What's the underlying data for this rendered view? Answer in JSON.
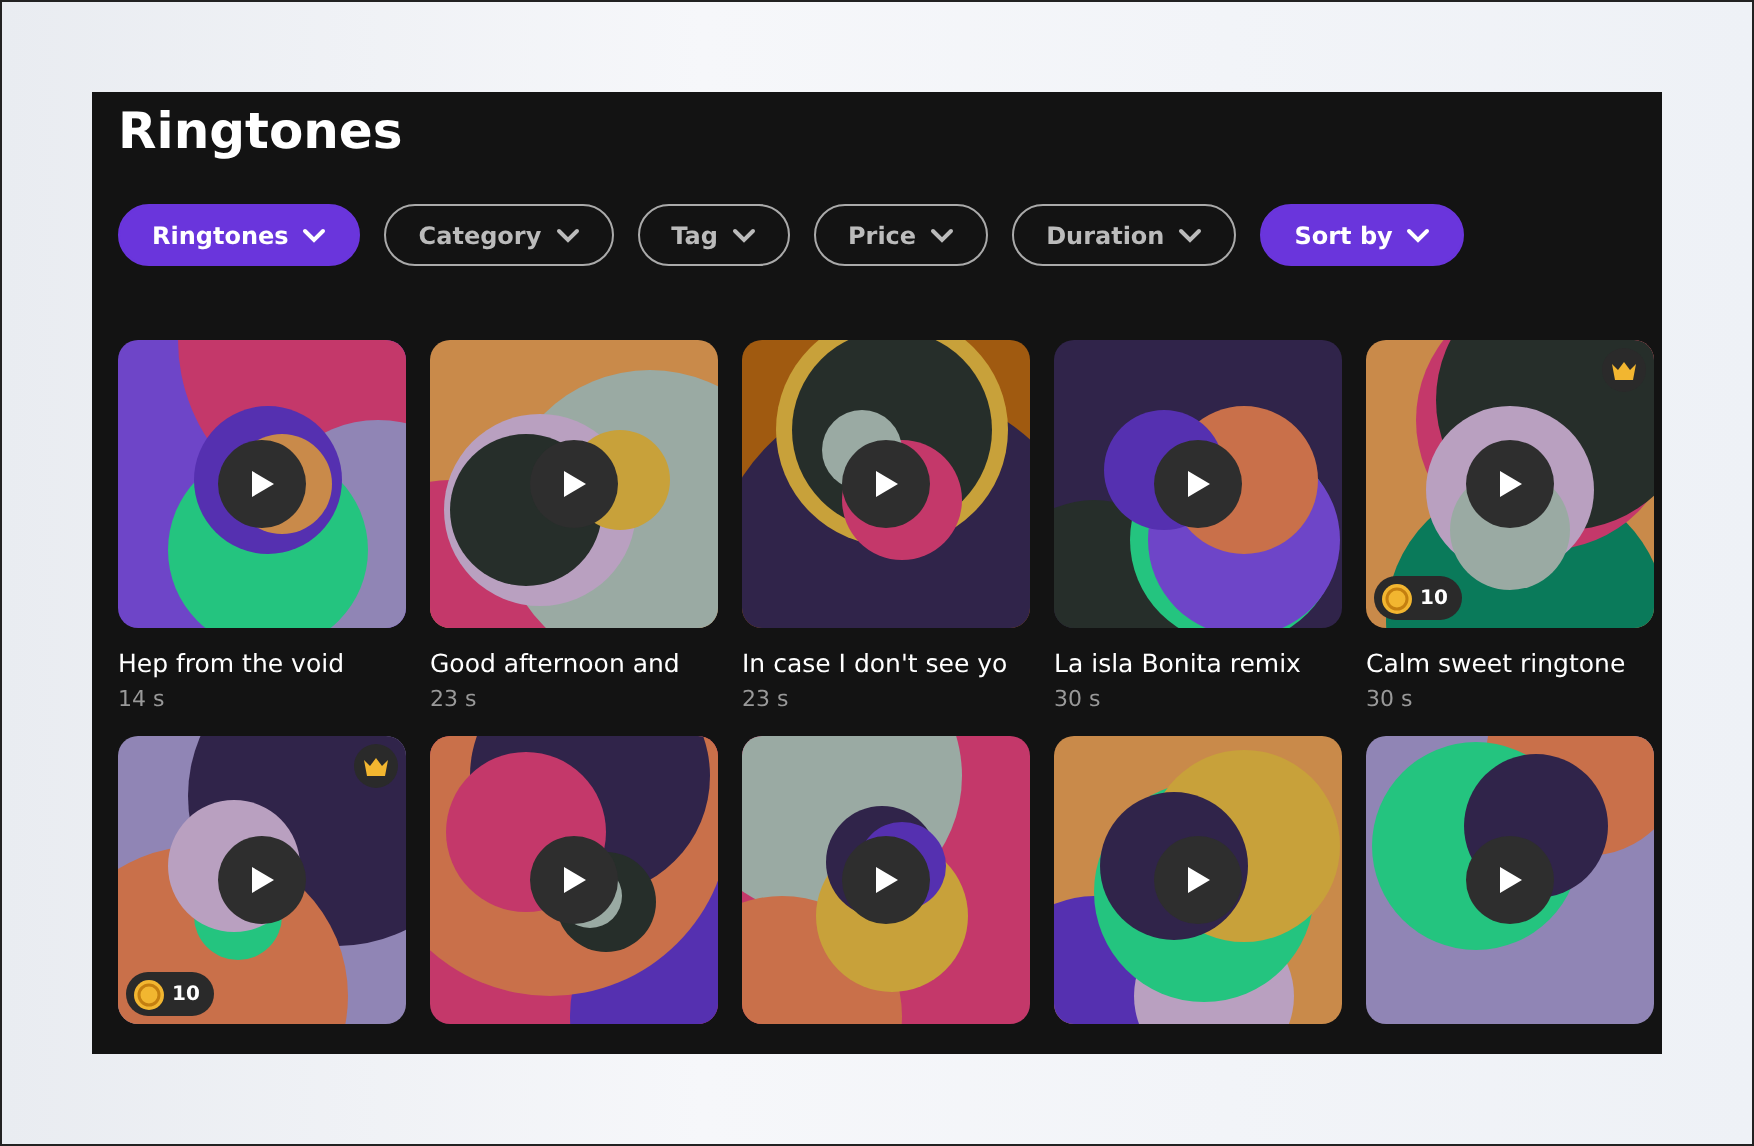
{
  "title": "Ringtones",
  "filters": [
    {
      "label": "Ringtones",
      "selected": true
    },
    {
      "label": "Category",
      "selected": false
    },
    {
      "label": "Tag",
      "selected": false
    },
    {
      "label": "Price",
      "selected": false
    },
    {
      "label": "Duration",
      "selected": false
    },
    {
      "label": "Sort by",
      "selected": true
    }
  ],
  "ringtones": [
    {
      "title": "Hep from the void",
      "duration": "14 s",
      "premium": false
    },
    {
      "title": "Good afternoon and",
      "duration": "23 s",
      "premium": false
    },
    {
      "title": "In case I don't see yo",
      "duration": "23 s",
      "premium": false
    },
    {
      "title": "La isla Bonita remix",
      "duration": "30 s",
      "premium": false
    },
    {
      "title": "Calm sweet ringtone",
      "duration": "30 s",
      "premium": true,
      "price": "10"
    },
    {
      "premium": true,
      "price": "10"
    },
    {
      "premium": false
    },
    {
      "premium": false
    },
    {
      "premium": false
    },
    {
      "premium": false
    }
  ]
}
